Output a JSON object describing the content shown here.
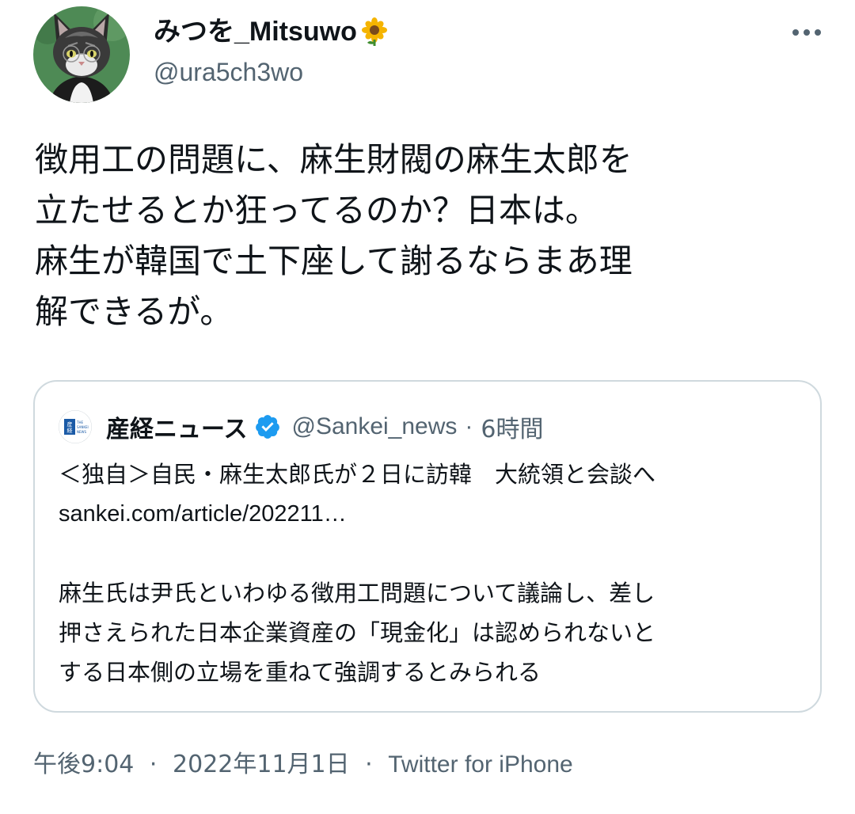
{
  "colors": {
    "text_primary": "#0f1419",
    "text_secondary": "#536471",
    "border": "#cfd9de",
    "verified": "#1d9bf0"
  },
  "author": {
    "display_name": "みつを_Mitsuwo",
    "name_emoji": "sunflower-icon",
    "handle": "@ura5ch3wo",
    "avatar": "cat-avatar"
  },
  "more_icon": "more-horizontal-icon",
  "tweet": {
    "lines": [
      "徴用工の問題に、麻生財閥の麻生太郎を",
      "立たせるとか狂ってるのか？日本は。",
      "麻生が韓国で土下座して謝るならまあ理",
      "解できるが。"
    ]
  },
  "quote": {
    "name": "産経ニュース",
    "verified_icon": "verified-badge-icon",
    "handle": "@Sankei_news",
    "separator": "·",
    "time": "6時間",
    "lines": [
      "＜独自＞自民・麻生太郎氏が２日に訪韓　大統領と会談へ",
      "sankei.com/article/202211…",
      "",
      "麻生氏は尹氏といわゆる徴用工問題について議論し、差し",
      "押さえられた日本企業資産の「現金化」は認められないと",
      "する日本側の立場を重ねて強調するとみられる"
    ],
    "logo_text": [
      "産",
      "経",
      "THE",
      "SANKEI",
      "NEWS"
    ]
  },
  "meta": {
    "time": "午後9:04",
    "date": "2022年11月1日",
    "source": "Twitter for iPhone",
    "separator": "·"
  }
}
